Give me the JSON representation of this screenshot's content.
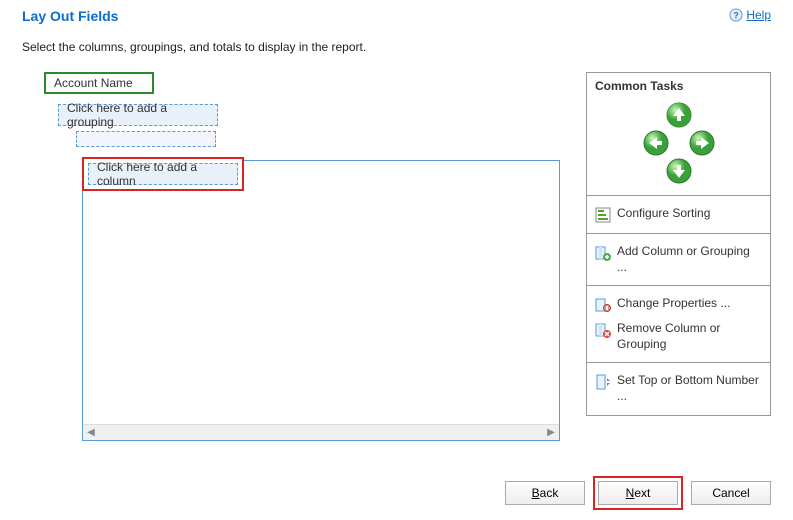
{
  "header": {
    "title": "Lay Out Fields",
    "help": "Help"
  },
  "instruction": "Select the columns, groupings, and totals to display in the report.",
  "design": {
    "account_name": "Account Name",
    "grouping_placeholder": "Click here to add a grouping",
    "column_placeholder": "Click here to add a column"
  },
  "sidebar": {
    "title": "Common Tasks",
    "tasks": {
      "configure_sorting": "Configure Sorting",
      "add_column": "Add Column or Grouping ...",
      "change_properties": "Change Properties ...",
      "remove_column": "Remove Column or Grouping",
      "set_top_bottom": "Set Top or Bottom Number ..."
    }
  },
  "buttons": {
    "back": "Back",
    "next": "Next",
    "cancel": "Cancel"
  }
}
